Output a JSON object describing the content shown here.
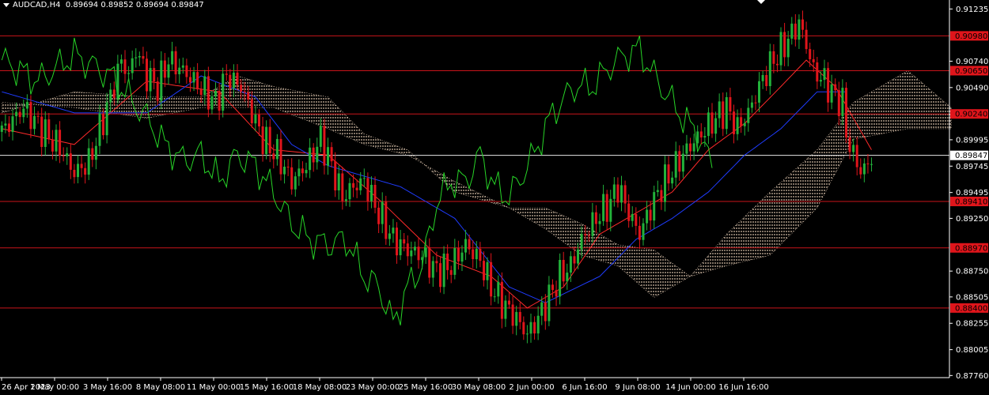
{
  "header": {
    "symbol": "AUDCAD,H4",
    "ohlc": "0.89694 0.89852 0.89694 0.89847"
  },
  "colors": {
    "background": "#000000",
    "axis": "#ffffff",
    "bull": "#22b13a",
    "bear": "#e0151b",
    "tenkan": "#ff2a2a",
    "kijun": "#1f3cff",
    "chikou": "#27d427",
    "cloud": "#ffe3c9",
    "level_line": "#c8141a",
    "current_line": "#e6e6e6",
    "level_label_bg": "#e0151b",
    "current_label_bg": "#ffffff"
  },
  "chart_data": {
    "type": "candlestick",
    "symbol": "AUDCAD",
    "timeframe": "H4",
    "y_range": [
      0.8774,
      0.9132
    ],
    "y_ticks": [
      "0.91235",
      "0.90740",
      "0.90490",
      "0.89995",
      "0.89745",
      "0.89495",
      "0.89250",
      "0.88750",
      "0.88505",
      "0.88255",
      "0.88005",
      "0.87760"
    ],
    "x_ticks": [
      "26 Apr 2023",
      "1 May 00:00",
      "3 May 16:00",
      "8 May 08:00",
      "11 May 00:00",
      "15 May 16:00",
      "18 May 08:00",
      "23 May 00:00",
      "25 May 16:00",
      "30 May 08:00",
      "2 Jun 00:00",
      "6 Jun 16:00",
      "9 Jun 08:00",
      "14 Jun 00:00",
      "16 Jun 16:00"
    ],
    "levels": [
      {
        "label": "0.90980",
        "value": 0.9098
      },
      {
        "label": "0.90650",
        "value": 0.9065
      },
      {
        "label": "0.90240",
        "value": 0.9024
      },
      {
        "label": "0.89410",
        "value": 0.8941
      },
      {
        "label": "0.88970",
        "value": 0.8897
      },
      {
        "label": "0.88400",
        "value": 0.884
      }
    ],
    "current_price": {
      "label": "0.89847",
      "value": 0.89847
    },
    "price_path": [
      [
        0,
        0.9007
      ],
      [
        6,
        0.903
      ],
      [
        12,
        0.9005
      ],
      [
        16,
        0.8992
      ],
      [
        20,
        0.8968
      ],
      [
        24,
        0.8978
      ],
      [
        30,
        0.904
      ],
      [
        33,
        0.9075
      ],
      [
        35,
        0.906
      ],
      [
        37,
        0.9085
      ],
      [
        40,
        0.906
      ],
      [
        43,
        0.905
      ],
      [
        46,
        0.9075
      ],
      [
        50,
        0.9065
      ],
      [
        53,
        0.9055
      ],
      [
        56,
        0.9045
      ],
      [
        59,
        0.9035
      ],
      [
        62,
        0.906
      ],
      [
        66,
        0.905
      ],
      [
        69,
        0.9025
      ],
      [
        72,
        0.9
      ],
      [
        76,
        0.8985
      ],
      [
        80,
        0.896
      ],
      [
        84,
        0.8975
      ],
      [
        88,
        0.9
      ],
      [
        91,
        0.8975
      ],
      [
        94,
        0.8945
      ],
      [
        97,
        0.8955
      ],
      [
        100,
        0.896
      ],
      [
        104,
        0.893
      ],
      [
        108,
        0.8905
      ],
      [
        112,
        0.8895
      ],
      [
        116,
        0.889
      ],
      [
        120,
        0.8875
      ],
      [
        124,
        0.888
      ],
      [
        128,
        0.89
      ],
      [
        132,
        0.8885
      ],
      [
        135,
        0.886
      ],
      [
        138,
        0.8845
      ],
      [
        142,
        0.883
      ],
      [
        145,
        0.8815
      ],
      [
        148,
        0.883
      ],
      [
        151,
        0.885
      ],
      [
        154,
        0.887
      ],
      [
        157,
        0.888
      ],
      [
        160,
        0.8905
      ],
      [
        164,
        0.8925
      ],
      [
        168,
        0.894
      ],
      [
        170,
        0.8955
      ],
      [
        173,
        0.893
      ],
      [
        176,
        0.891
      ],
      [
        179,
        0.8935
      ],
      [
        182,
        0.8955
      ],
      [
        185,
        0.897
      ],
      [
        189,
        0.899
      ],
      [
        193,
        0.9005
      ],
      [
        197,
        0.902
      ],
      [
        200,
        0.903
      ],
      [
        203,
        0.901
      ],
      [
        206,
        0.9025
      ],
      [
        209,
        0.905
      ],
      [
        212,
        0.907
      ],
      [
        215,
        0.9085
      ],
      [
        218,
        0.91
      ],
      [
        220,
        0.911
      ],
      [
        222,
        0.909
      ],
      [
        224,
        0.9065
      ],
      [
        227,
        0.9055
      ],
      [
        230,
        0.904
      ],
      [
        232,
        0.9035
      ],
      [
        233,
        0.9005
      ],
      [
        235,
        0.8985
      ],
      [
        237,
        0.897
      ],
      [
        239,
        0.8975
      ],
      [
        240,
        0.8985
      ]
    ],
    "series": [
      {
        "name": "Tenkan-sen",
        "values": [
          [
            0,
            0.901
          ],
          [
            20,
            0.8995
          ],
          [
            40,
            0.9055
          ],
          [
            60,
            0.9045
          ],
          [
            75,
            0.899
          ],
          [
            90,
            0.8985
          ],
          [
            105,
            0.894
          ],
          [
            120,
            0.889
          ],
          [
            135,
            0.887
          ],
          [
            145,
            0.884
          ],
          [
            155,
            0.886
          ],
          [
            165,
            0.891
          ],
          [
            175,
            0.893
          ],
          [
            185,
            0.895
          ],
          [
            195,
            0.899
          ],
          [
            205,
            0.9015
          ],
          [
            215,
            0.905
          ],
          [
            222,
            0.9075
          ],
          [
            230,
            0.905
          ],
          [
            240,
            0.899
          ]
        ]
      },
      {
        "name": "Kijun-sen",
        "values": [
          [
            0,
            0.9045
          ],
          [
            20,
            0.9025
          ],
          [
            40,
            0.9025
          ],
          [
            55,
            0.906
          ],
          [
            70,
            0.904
          ],
          [
            80,
            0.8995
          ],
          [
            90,
            0.8975
          ],
          [
            110,
            0.8955
          ],
          [
            125,
            0.8925
          ],
          [
            140,
            0.886
          ],
          [
            150,
            0.8845
          ],
          [
            165,
            0.887
          ],
          [
            175,
            0.8905
          ],
          [
            185,
            0.8925
          ],
          [
            195,
            0.895
          ],
          [
            205,
            0.8985
          ],
          [
            215,
            0.901
          ],
          [
            225,
            0.9045
          ],
          [
            233,
            0.9045
          ]
        ]
      },
      {
        "name": "Chikou",
        "values": [
          [
            0,
            0.9075
          ],
          [
            10,
            0.9055
          ],
          [
            20,
            0.908
          ],
          [
            30,
            0.906
          ],
          [
            40,
            0.902
          ],
          [
            45,
            0.8995
          ],
          [
            50,
            0.898
          ],
          [
            55,
            0.8985
          ],
          [
            60,
            0.896
          ],
          [
            65,
            0.8985
          ],
          [
            70,
            0.8975
          ],
          [
            75,
            0.895
          ],
          [
            80,
            0.892
          ],
          [
            85,
            0.8905
          ],
          [
            90,
            0.89
          ],
          [
            95,
            0.8905
          ],
          [
            100,
            0.887
          ],
          [
            104,
            0.886
          ],
          [
            108,
            0.8825
          ],
          [
            112,
            0.886
          ],
          [
            116,
            0.888
          ],
          [
            120,
            0.894
          ],
          [
            124,
            0.896
          ],
          [
            128,
            0.896
          ],
          [
            132,
            0.8985
          ],
          [
            136,
            0.8955
          ],
          [
            140,
            0.8945
          ],
          [
            146,
            0.898
          ],
          [
            152,
            0.9025
          ],
          [
            158,
            0.905
          ],
          [
            163,
            0.905
          ],
          [
            168,
            0.907
          ],
          [
            172,
            0.908
          ],
          [
            176,
            0.9085
          ],
          [
            180,
            0.906
          ],
          [
            184,
            0.904
          ],
          [
            188,
            0.902
          ],
          [
            192,
            0.9005
          ],
          [
            196,
            0.8975
          ]
        ]
      },
      {
        "name": "Senkou A",
        "values": [
          [
            0,
            0.9025
          ],
          [
            20,
            0.9045
          ],
          [
            40,
            0.904
          ],
          [
            55,
            0.904
          ],
          [
            65,
            0.906
          ],
          [
            75,
            0.905
          ],
          [
            90,
            0.904
          ],
          [
            100,
            0.9005
          ],
          [
            112,
            0.899
          ],
          [
            125,
            0.895
          ],
          [
            140,
            0.8935
          ],
          [
            150,
            0.8915
          ],
          [
            160,
            0.889
          ],
          [
            170,
            0.888
          ],
          [
            180,
            0.885
          ],
          [
            190,
            0.887
          ],
          [
            200,
            0.891
          ],
          [
            212,
            0.895
          ],
          [
            225,
            0.899
          ],
          [
            235,
            0.9035
          ],
          [
            250,
            0.9065
          ],
          [
            262,
            0.903
          ]
        ]
      },
      {
        "name": "Senkou B",
        "values": [
          [
            0,
            0.9035
          ],
          [
            20,
            0.903
          ],
          [
            40,
            0.902
          ],
          [
            55,
            0.903
          ],
          [
            65,
            0.903
          ],
          [
            75,
            0.903
          ],
          [
            90,
            0.901
          ],
          [
            100,
            0.8995
          ],
          [
            112,
            0.8985
          ],
          [
            125,
            0.896
          ],
          [
            140,
            0.8935
          ],
          [
            150,
            0.8935
          ],
          [
            160,
            0.892
          ],
          [
            170,
            0.89
          ],
          [
            180,
            0.8895
          ],
          [
            190,
            0.887
          ],
          [
            200,
            0.888
          ],
          [
            212,
            0.889
          ],
          [
            225,
            0.8935
          ],
          [
            235,
            0.9
          ],
          [
            250,
            0.901
          ],
          [
            262,
            0.901
          ]
        ]
      }
    ]
  }
}
